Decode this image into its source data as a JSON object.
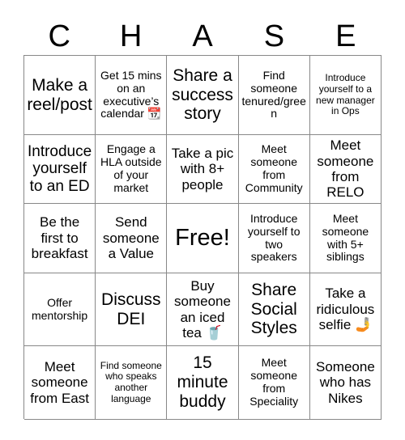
{
  "header": {
    "letters": [
      "C",
      "H",
      "A",
      "S",
      "E"
    ]
  },
  "grid": {
    "rows": 5,
    "columns": 5,
    "free_space_label": "Free!",
    "cells": [
      {
        "text": "Make a reel/post",
        "size": "xl"
      },
      {
        "text": "Get 15 mins on an executive’s calendar 📆",
        "size": "sm"
      },
      {
        "text": "Share a success story",
        "size": "xl"
      },
      {
        "text": "Find someone tenured/green",
        "size": "sm"
      },
      {
        "text": "Introduce yourself to a new manager in Ops",
        "size": "xs"
      },
      {
        "text": "Introduce yourself to an ED",
        "size": "lg"
      },
      {
        "text": "Engage a HLA outside of your market",
        "size": "sm"
      },
      {
        "text": "Take a pic with 8+ people",
        "size": "md"
      },
      {
        "text": "Meet someone from Community",
        "size": "sm"
      },
      {
        "text": "Meet someone from RELO",
        "size": "md"
      },
      {
        "text": "Be the first to breakfast",
        "size": "md"
      },
      {
        "text": "Send someone a Value",
        "size": "md"
      },
      {
        "text": "Free!",
        "size": "xxl"
      },
      {
        "text": "Introduce yourself to two speakers",
        "size": "sm"
      },
      {
        "text": "Meet someone with 5+ siblings",
        "size": "sm"
      },
      {
        "text": "Offer mentorship",
        "size": "sm"
      },
      {
        "text": "Discuss DEI",
        "size": "xl"
      },
      {
        "text": "Buy someone an iced tea 🥤",
        "size": "md"
      },
      {
        "text": "Share Social Styles",
        "size": "xl"
      },
      {
        "text": "Take a ridiculous selfie 🤳",
        "size": "md"
      },
      {
        "text": "Meet someone from East",
        "size": "md"
      },
      {
        "text": "Find someone who speaks another language",
        "size": "xs"
      },
      {
        "text": "15 minute buddy",
        "size": "xl"
      },
      {
        "text": "Meet someone from Speciality",
        "size": "sm"
      },
      {
        "text": "Someone who has Nikes",
        "size": "md"
      }
    ]
  },
  "colors": {
    "background": "#ffffff",
    "text": "#000000",
    "grid_line": "#888888"
  }
}
